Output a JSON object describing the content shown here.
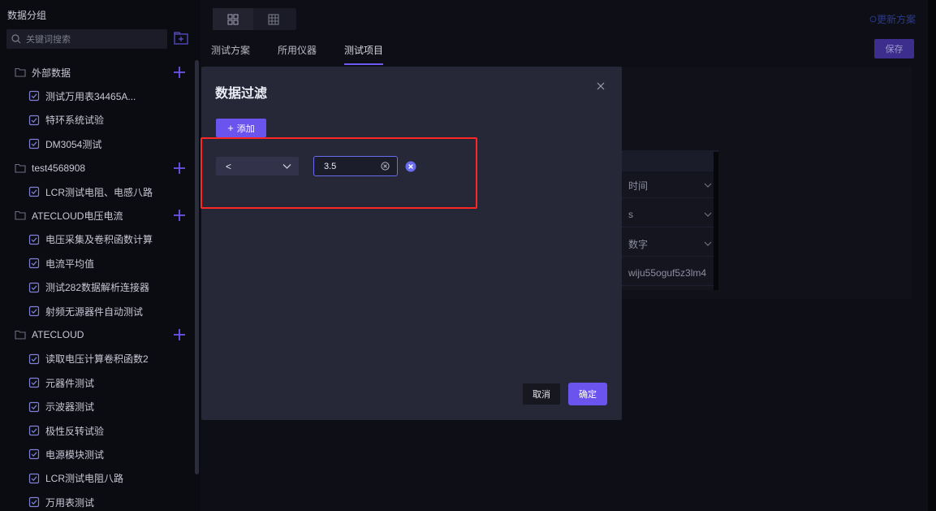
{
  "sidebar": {
    "title": "数据分组",
    "search_placeholder": "关键词搜索",
    "groups": [
      {
        "label": "外部数据",
        "items": [
          "测试万用表34465A...",
          "特环系统试验",
          "DM3054测试"
        ]
      },
      {
        "label": "test4568908",
        "items": [
          "LCR测试电阻、电感八路"
        ]
      },
      {
        "label": "ATECLOUD电压电流",
        "items": [
          "电压采集及卷积函数计算",
          "电流平均值",
          "测试282数据解析连接器",
          "射频无源器件自动测试"
        ]
      },
      {
        "label": "ATECLOUD",
        "items": [
          "读取电压计算卷积函数2",
          "元器件测试",
          "示波器测试",
          "极性反转试验",
          "电源模块测试",
          "LCR测试电阻八路",
          "万用表测试"
        ]
      }
    ]
  },
  "main": {
    "tabs": [
      "测试方案",
      "所用仪器",
      "测试项目"
    ],
    "active_tab": 2,
    "update_plan_label": "更新方案",
    "save_label": "保存",
    "bg_fields": [
      "时间",
      "s",
      "数字",
      "wiju55oguf5z3lm4"
    ]
  },
  "modal": {
    "title": "数据过滤",
    "add_label": "添加",
    "filter": {
      "operator": "<",
      "value": "3.5"
    },
    "cancel_label": "取消",
    "confirm_label": "确定"
  },
  "colors": {
    "accent": "#6b53ee",
    "highlight": "#ff2626",
    "modal_bg": "#262737"
  }
}
